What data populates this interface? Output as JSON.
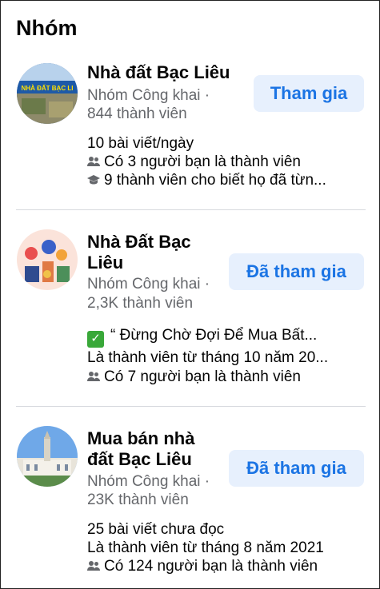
{
  "section_title": "Nhóm",
  "groups": [
    {
      "name": "Nhà đất Bạc Liêu",
      "privacy": "Nhóm Công khai ·",
      "members": "844 thành viên",
      "button": "Tham gia",
      "line1": "10 bài viết/ngày",
      "line2": "Có 3 người bạn là thành viên",
      "line3": "9 thành viên cho biết họ đã từn...",
      "avatar_text": "NHÀ ĐẤT BẠC LI"
    },
    {
      "name": "Nhà Đất Bạc Liêu",
      "privacy": "Nhóm Công khai ·",
      "members": "2,3K thành viên",
      "button": "Đã tham gia",
      "line1": "“ Đừng Chờ Đợi Để Mua Bất...",
      "line2": "Là thành viên từ tháng 10 năm 20...",
      "line3": "Có 7 người bạn là thành viên"
    },
    {
      "name": "Mua bán nhà đất Bạc Liêu",
      "privacy": "Nhóm Công khai ·",
      "members": "23K thành viên",
      "button": "Đã tham gia",
      "line1": "25 bài viết chưa đọc",
      "line2": "Là thành viên từ tháng 8 năm 2021",
      "line3": "Có 124 người bạn là thành viên"
    }
  ],
  "colors": {
    "accent": "#1b74e4",
    "button_bg": "#e7f0fd",
    "secondary_text": "#65676b"
  }
}
